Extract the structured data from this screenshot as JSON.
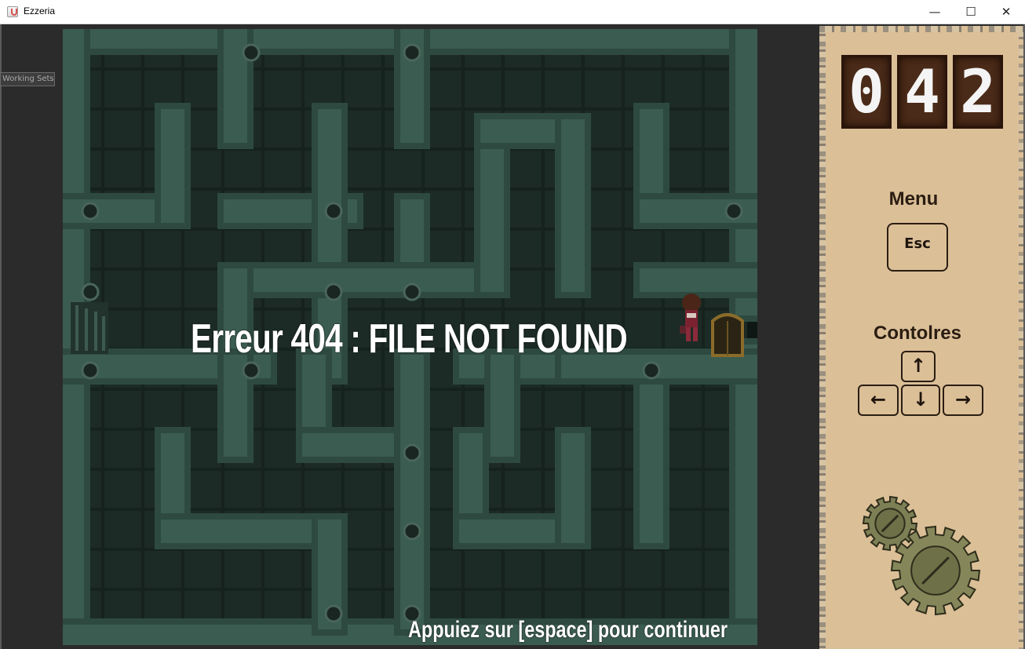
{
  "window": {
    "title": "Ezzeria",
    "minimize_glyph": "—",
    "maximize_glyph": "☐",
    "close_glyph": "✕",
    "icon": "java-app-icon"
  },
  "side_tab": {
    "label": "Working Sets"
  },
  "overlay": {
    "error_message": "Erreur 404 : FILE NOT FOUND",
    "continue_hint": "Appuiez sur [espace] pour continuer"
  },
  "panel": {
    "counter_digits": [
      "0",
      "4",
      "2"
    ],
    "menu_label": "Menu",
    "menu_key": "Esc",
    "controls_label": "Contolres",
    "keys": {
      "up": "↑",
      "left": "←",
      "down": "↓",
      "right": "→"
    },
    "decoration_icons": [
      "small-gear-icon",
      "large-gear-icon"
    ]
  },
  "colors": {
    "maze_wall": "#2e4a40",
    "maze_floor": "#18251f",
    "panel_bg": "#dbbf97",
    "counter_bg": "#4a2a18"
  }
}
